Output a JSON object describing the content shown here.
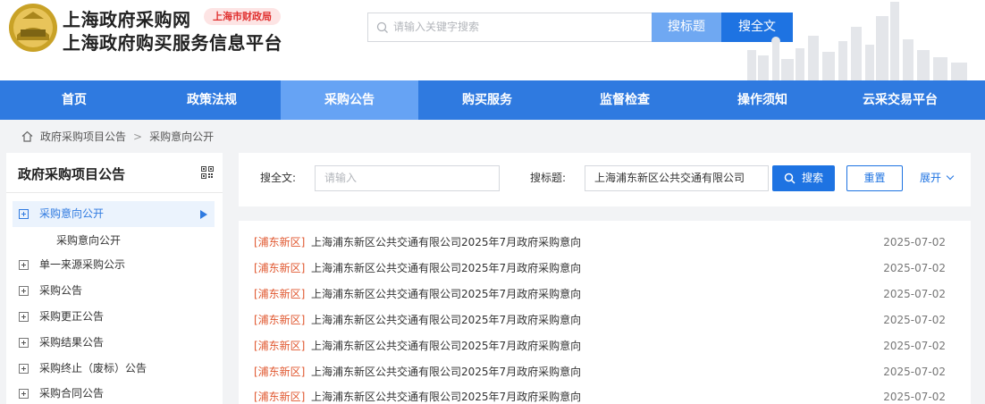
{
  "header": {
    "site_title": "上海政府采购网",
    "site_subtitle": "上海政府购买服务信息平台",
    "badge": "上海市财政局",
    "search_placeholder": "请输入关键字搜索",
    "btn_search_title": "搜标题",
    "btn_search_full": "搜全文"
  },
  "nav": [
    {
      "label": "首页",
      "active": false
    },
    {
      "label": "政策法规",
      "active": false
    },
    {
      "label": "采购公告",
      "active": true
    },
    {
      "label": "购买服务",
      "active": false
    },
    {
      "label": "监督检查",
      "active": false
    },
    {
      "label": "操作须知",
      "active": false
    },
    {
      "label": "云采交易平台",
      "active": false
    }
  ],
  "breadcrumb": [
    "政府采购项目公告",
    "采购意向公开"
  ],
  "sidebar": {
    "title": "政府采购项目公告",
    "items": [
      {
        "label": "采购意向公开",
        "active": true
      },
      {
        "label": "单一来源采购公示",
        "active": false
      },
      {
        "label": "采购公告",
        "active": false
      },
      {
        "label": "采购更正公告",
        "active": false
      },
      {
        "label": "采购结果公告",
        "active": false
      },
      {
        "label": "采购终止（废标）公告",
        "active": false
      },
      {
        "label": "采购合同公告",
        "active": false
      }
    ],
    "sub_item": "采购意向公开"
  },
  "filter": {
    "fulltext_label": "搜全文:",
    "fulltext_placeholder": "请输入",
    "title_label": "搜标题:",
    "title_value": "上海浦东新区公共交通有限公司",
    "search_button": "搜索",
    "reset_button": "重置",
    "expand_button": "展开"
  },
  "list": [
    {
      "tag": "[浦东新区]",
      "title": "上海浦东新区公共交通有限公司2025年7月政府采购意向",
      "date": "2025-07-02"
    },
    {
      "tag": "[浦东新区]",
      "title": "上海浦东新区公共交通有限公司2025年7月政府采购意向",
      "date": "2025-07-02"
    },
    {
      "tag": "[浦东新区]",
      "title": "上海浦东新区公共交通有限公司2025年7月政府采购意向",
      "date": "2025-07-02"
    },
    {
      "tag": "[浦东新区]",
      "title": "上海浦东新区公共交通有限公司2025年7月政府采购意向",
      "date": "2025-07-02"
    },
    {
      "tag": "[浦东新区]",
      "title": "上海浦东新区公共交通有限公司2025年7月政府采购意向",
      "date": "2025-07-02"
    },
    {
      "tag": "[浦东新区]",
      "title": "上海浦东新区公共交通有限公司2025年7月政府采购意向",
      "date": "2025-07-02"
    },
    {
      "tag": "[浦东新区]",
      "title": "上海浦东新区公共交通有限公司2025年7月政府采购意向",
      "date": "2025-07-02"
    }
  ],
  "colors": {
    "nav_bg": "#2f7ae0",
    "nav_active": "#66a3f4",
    "primary": "#1e73e2",
    "tag": "#e0572f",
    "badge_text": "#e0302f"
  },
  "icons": {
    "logo": "shanghai-emblem-logo",
    "search": "search-icon",
    "home": "home-icon",
    "qr": "qr-code-icon",
    "expand": "plus-box-icon",
    "arrow": "triangle-right-icon"
  }
}
